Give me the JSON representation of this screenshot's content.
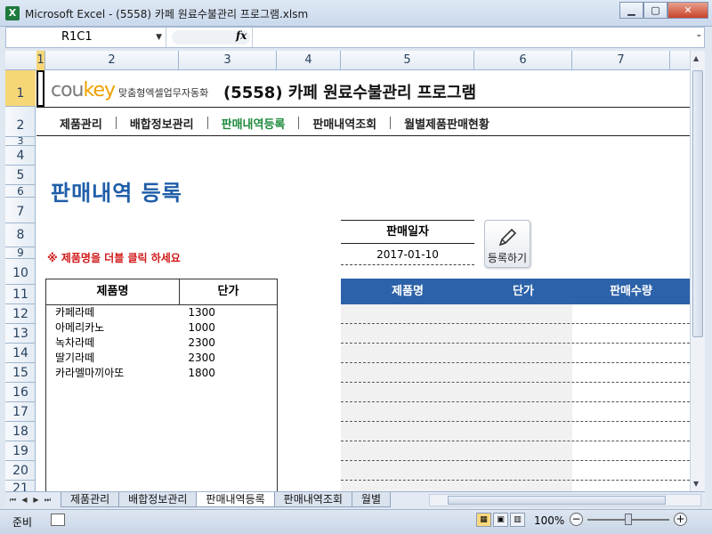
{
  "window": {
    "title": "Microsoft Excel - (5558) 카페 원료수불관리 프로그램.xlsm",
    "app_icon": "X"
  },
  "formula": {
    "namebox": "R1C1",
    "fx": "fx"
  },
  "columns": [
    "1",
    "2",
    "3",
    "4",
    "5",
    "6",
    "7"
  ],
  "rows": [
    "1",
    "2",
    "3",
    "4",
    "5",
    "6",
    "7",
    "8",
    "9",
    "10",
    "11",
    "12",
    "13",
    "14",
    "15",
    "16",
    "17",
    "18",
    "19",
    "20",
    "21"
  ],
  "brand": {
    "logo_main": "cou",
    "logo_accent": "key",
    "logo_sub": "맞춤형엑셀업무자동화",
    "title": "(5558) 카페 원료수불관리 프로그램"
  },
  "nav": [
    "제품관리",
    "배합정보관리",
    "판매내역등록",
    "판매내역조회",
    "월별제품판매현황"
  ],
  "page": {
    "heading": "판매내역 등록",
    "hint": "※ 제품명을 더블 클릭 하세요"
  },
  "products": {
    "headers": [
      "제품명",
      "단가"
    ],
    "rows": [
      [
        "카페라떼",
        "1300"
      ],
      [
        "아메리카노",
        "1000"
      ],
      [
        "녹차라떼",
        "2300"
      ],
      [
        "딸기라떼",
        "2300"
      ],
      [
        "카라멜마끼아또",
        "1800"
      ]
    ]
  },
  "sale_date": {
    "label": "판매일자",
    "value": "2017-01-10"
  },
  "register_button": {
    "label": "등록하기"
  },
  "sales_table": {
    "headers": [
      "제품명",
      "단가",
      "판매수량"
    ]
  },
  "sheet_tabs": [
    "제품관리",
    "배합정보관리",
    "판매내역등록",
    "판매내역조회",
    "월별"
  ],
  "status": {
    "text": "준비",
    "zoom": "100%"
  }
}
